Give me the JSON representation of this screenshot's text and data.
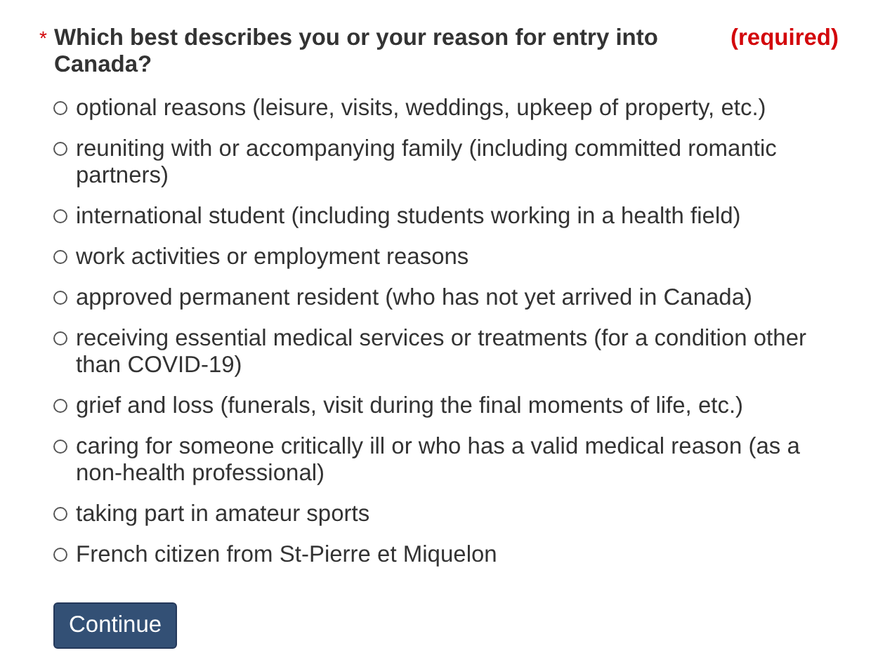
{
  "question": {
    "asterisk": "*",
    "text": "Which best describes you or your reason for entry into Canada?",
    "required_note": "(required)"
  },
  "options": [
    {
      "label": "optional reasons (leisure, visits, weddings, upkeep of property, etc.)",
      "selected": false
    },
    {
      "label": "reuniting with or accompanying family (including committed romantic partners)",
      "selected": false
    },
    {
      "label": "international student (including students working in a health field)",
      "selected": false
    },
    {
      "label": "work activities or employment reasons",
      "selected": false
    },
    {
      "label": "approved permanent resident (who has not yet arrived in Canada)",
      "selected": false
    },
    {
      "label": "receiving essential medical services or treatments (for a condition other than COVID-19)",
      "selected": false
    },
    {
      "label": "grief and loss (funerals, visit during the final moments of life, etc.)",
      "selected": false
    },
    {
      "label": "caring for someone critically ill or who has a valid medical reason (as a non-health professional)",
      "selected": false
    },
    {
      "label": "taking part in amateur sports",
      "selected": false
    },
    {
      "label": "French citizen from St-Pierre et Miquelon",
      "selected": false
    }
  ],
  "continue_button": "Continue"
}
